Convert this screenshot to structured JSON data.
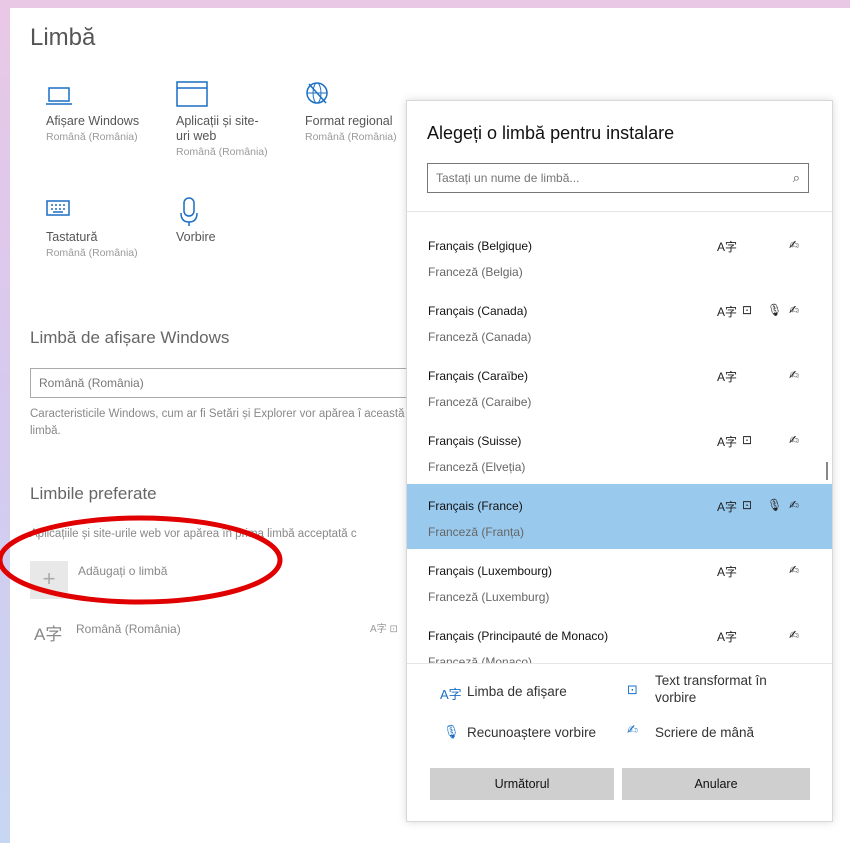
{
  "page": {
    "title": "Limbă"
  },
  "tiles": [
    {
      "icon": "laptop-icon",
      "label": "Afișare Windows",
      "sub": "Română (România)"
    },
    {
      "icon": "window-icon",
      "label": "Aplicații și site-uri web",
      "sub": "Română (România)"
    },
    {
      "icon": "globe-icon",
      "label": "Format regional",
      "sub": "Română (România)"
    },
    {
      "icon": "keyboard-icon",
      "label": "Tastatură",
      "sub": "Română (România)"
    },
    {
      "icon": "microphone-icon",
      "label": "Vorbire",
      "sub": ""
    }
  ],
  "display_language": {
    "title": "Limbă de afișare Windows",
    "value": "Română (România)",
    "description": "Caracteristicile Windows, cum ar fi Setări și Explorer vor apărea î această limbă."
  },
  "preferred": {
    "title": "Limbile preferate",
    "description": "Aplicațiile și site-urile web vor apărea în prima limbă acceptată c",
    "add_label": "Adăugați o limbă",
    "items": [
      {
        "label": "Română (România)"
      }
    ]
  },
  "dialog": {
    "title": "Alegeți o limbă pentru instalare",
    "search_placeholder": "Tastați un nume de limbă...",
    "languages": [
      {
        "name": "Français (Belgique)",
        "sub": "Franceză (Belgia)",
        "features": [
          "display",
          "handwriting"
        ],
        "selected": false
      },
      {
        "name": "Français (Canada)",
        "sub": "Franceză (Canada)",
        "features": [
          "display",
          "tts",
          "speech",
          "handwriting"
        ],
        "selected": false
      },
      {
        "name": "Français (Caraïbe)",
        "sub": "Franceză (Caraibe)",
        "features": [
          "display",
          "handwriting"
        ],
        "selected": false
      },
      {
        "name": "Français (Suisse)",
        "sub": "Franceză (Elveția)",
        "features": [
          "display",
          "tts",
          "handwriting"
        ],
        "selected": false
      },
      {
        "name": "Français (France)",
        "sub": "Franceză (Franța)",
        "features": [
          "display",
          "tts",
          "speech",
          "handwriting"
        ],
        "selected": true
      },
      {
        "name": "Français (Luxembourg)",
        "sub": "Franceză (Luxemburg)",
        "features": [
          "display",
          "handwriting"
        ],
        "selected": false
      },
      {
        "name": "Français (Principauté de Monaco)",
        "sub": "Franceză (Monaco)",
        "features": [
          "display",
          "handwriting"
        ],
        "selected": false
      }
    ],
    "legend": {
      "display": "Limba de afișare",
      "tts": "Text transformat în vorbire",
      "speech": "Recunoaștere vorbire",
      "handwriting": "Scriere de mână"
    },
    "next_label": "Următorul",
    "cancel_label": "Anulare"
  },
  "colors": {
    "accent": "#1a6fc4",
    "selected_row": "#99c9ed",
    "annotation": "#e00000"
  }
}
